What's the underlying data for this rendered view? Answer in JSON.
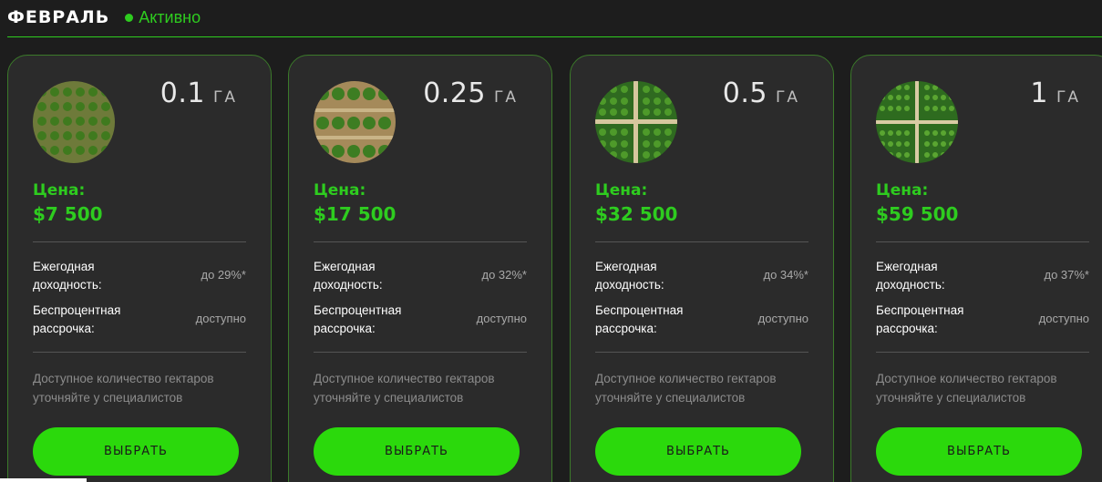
{
  "header": {
    "month": "ФЕВРАЛЬ",
    "status": "Активно",
    "status_color": "#2ecc1f"
  },
  "labels": {
    "price": "Цена:",
    "yield_line1": "Ежегодная",
    "yield_line2": "доходность:",
    "installment_line1": "Беспроцентная",
    "installment_line2": "рассрочка:",
    "note_line1": "Доступное количество гектаров",
    "note_line2": "уточняйте у специалистов",
    "unit": "ГА",
    "button": "ВЫБРАТЬ"
  },
  "cards": [
    {
      "area": "0.1",
      "price": "$7 500",
      "yield": "до 29%*",
      "installment": "доступно",
      "image_icon": "plantation-photo-icon"
    },
    {
      "area": "0.25",
      "price": "$17 500",
      "yield": "до 32%*",
      "installment": "доступно",
      "image_icon": "plantation-photo-icon"
    },
    {
      "area": "0.5",
      "price": "$32 500",
      "yield": "до 34%*",
      "installment": "доступно",
      "image_icon": "plantation-photo-icon"
    },
    {
      "area": "1",
      "price": "$59 500",
      "yield": "до 37%*",
      "installment": "доступно",
      "image_icon": "plantation-photo-icon"
    }
  ],
  "colors": {
    "accent": "#2bd90c",
    "background": "#1d1d1d",
    "card": "#2b2b2b"
  }
}
